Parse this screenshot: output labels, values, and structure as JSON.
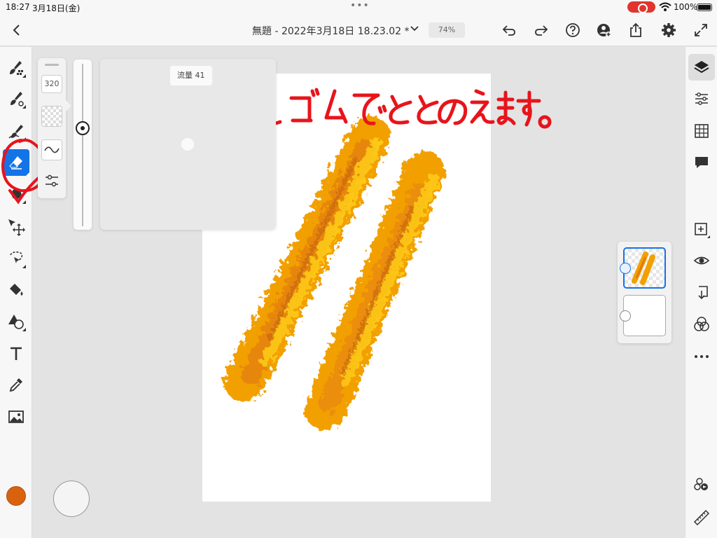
{
  "status_bar": {
    "time": "18:27",
    "date": "3月18日(金)",
    "battery": "100%"
  },
  "document": {
    "title": "無題 - 2022年3月18日 18.23.02 *",
    "zoom": "74%"
  },
  "top_actions": [
    "undo-icon",
    "redo-icon",
    "help-icon",
    "invite-icon",
    "share-icon",
    "settings-icon",
    "fullscreen-icon"
  ],
  "left_tools": [
    "pixel-brush",
    "live-brush",
    "vector-brush",
    "eraser",
    "smudge",
    "move-transform",
    "selection",
    "fill",
    "shapes",
    "type",
    "eyedropper",
    "image",
    "color"
  ],
  "active_tool": "eraser",
  "current_color": "#d9620f",
  "brush_settings": {
    "size": "320",
    "flow_label": "流量 41",
    "flow_value": 41
  },
  "canvas": {
    "annotation_text": "消しゴムで ととのえます。",
    "annotation_color": "#e8141b",
    "stroke_colors": [
      "#f5a000",
      "#ffcc00",
      "#e87e0a",
      "#c9690c"
    ]
  },
  "layers": {
    "count": 2,
    "selected_index": 0
  },
  "right_tools": [
    "layers",
    "layer-properties",
    "grid",
    "comments",
    "add-layer",
    "visibility",
    "import",
    "blend-mode",
    "more",
    "sync",
    "ruler"
  ]
}
